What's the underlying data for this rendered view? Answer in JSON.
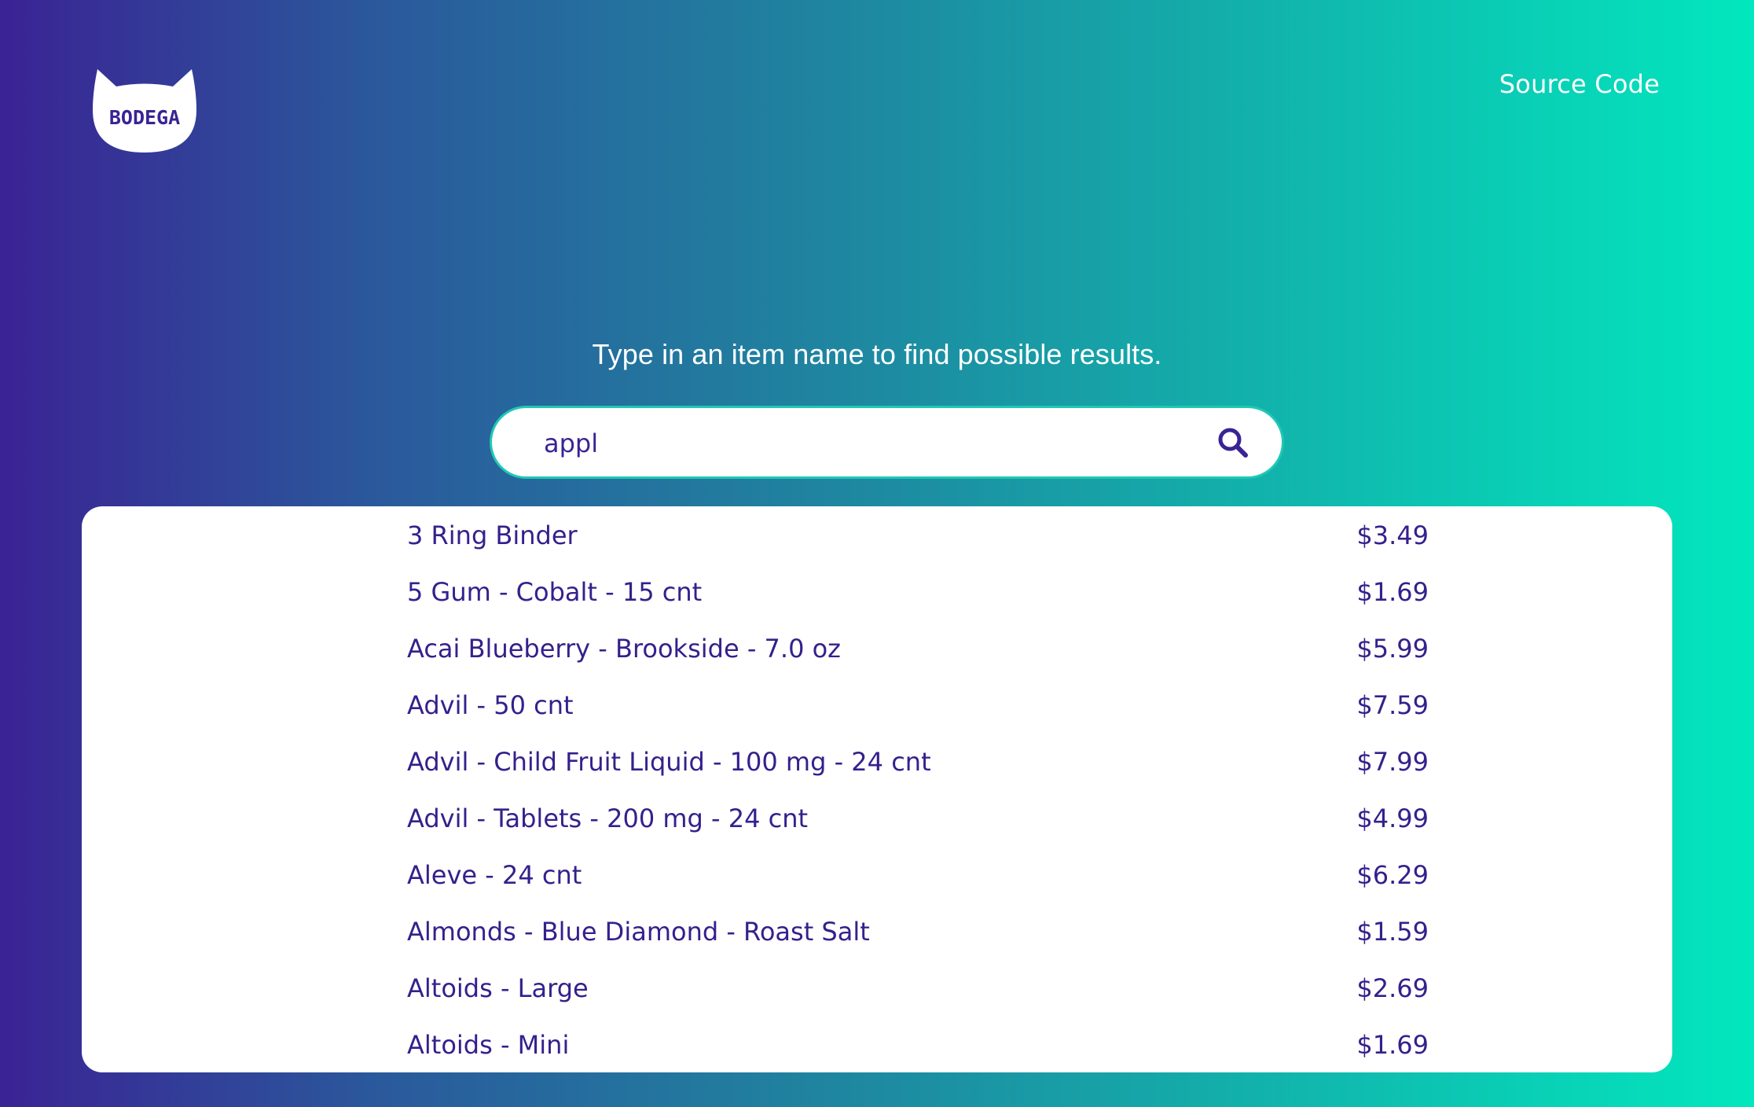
{
  "header": {
    "logo_text": "BODEGA",
    "source_link": "Source Code"
  },
  "main": {
    "prompt": "Type in an item name to find possible results.",
    "search": {
      "value": "appl"
    },
    "results": [
      {
        "name": "3 Ring Binder",
        "price": "$3.49"
      },
      {
        "name": "5 Gum - Cobalt - 15 cnt",
        "price": "$1.69"
      },
      {
        "name": "Acai Blueberry - Brookside - 7.0 oz",
        "price": "$5.99"
      },
      {
        "name": "Advil - 50 cnt",
        "price": "$7.59"
      },
      {
        "name": "Advil - Child Fruit Liquid - 100 mg - 24 cnt",
        "price": "$7.99"
      },
      {
        "name": "Advil - Tablets - 200 mg - 24 cnt",
        "price": "$4.99"
      },
      {
        "name": "Aleve - 24 cnt",
        "price": "$6.29"
      },
      {
        "name": "Almonds - Blue Diamond - Roast Salt",
        "price": "$1.59"
      },
      {
        "name": "Altoids - Large",
        "price": "$2.69"
      },
      {
        "name": "Altoids - Mini",
        "price": "$1.69"
      }
    ]
  },
  "colors": {
    "brand_purple": "#3a2394",
    "accent_teal": "#02e7be",
    "text_dark": "#35208c"
  },
  "icons": {
    "search": "search-icon",
    "logo": "cat-head-logo-icon"
  }
}
